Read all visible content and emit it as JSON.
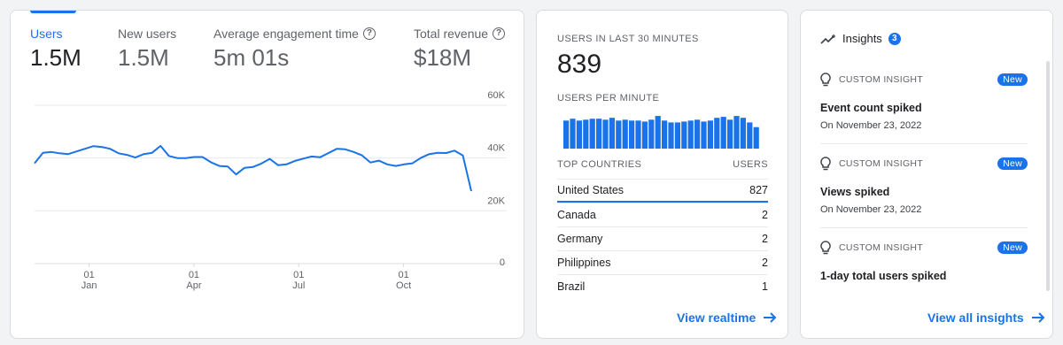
{
  "overview": {
    "metrics": [
      {
        "label": "Users",
        "value": "1.5M",
        "active": true,
        "help": false
      },
      {
        "label": "New users",
        "value": "1.5M",
        "active": false,
        "help": false
      },
      {
        "label": "Average engagement time",
        "value": "5m 01s",
        "active": false,
        "help": true
      },
      {
        "label": "Total revenue",
        "value": "$18M",
        "active": false,
        "help": true
      }
    ],
    "help_glyph": "?"
  },
  "chart_data": {
    "type": "line",
    "series": [
      {
        "values": [
          38,
          42,
          42.3,
          41.8,
          41.5,
          42.5,
          43.5,
          44.5,
          44.2,
          43.5,
          41.8,
          41.2,
          40.2,
          41.5,
          42,
          44.6,
          40.8,
          40,
          40,
          40.4,
          40.4,
          38.4,
          37,
          36.8,
          33.8,
          36.3,
          36.6,
          37.9,
          39.7,
          37.3,
          37.6,
          38.9,
          39.8,
          40.6,
          40.3,
          41.9,
          43.5,
          43.3,
          42.3,
          41,
          38.3,
          39,
          37.6,
          37,
          37.6,
          38,
          40.1,
          41.5,
          42,
          41.9,
          42.8,
          41,
          27.5
        ],
        "color": "#1a73e8"
      }
    ],
    "ylim": [
      0,
      60
    ],
    "y_ticks": [
      "0",
      "20K",
      "40K",
      "60K"
    ],
    "x_ticks": [
      {
        "day": "01",
        "month": "Jan"
      },
      {
        "day": "01",
        "month": "Apr"
      },
      {
        "day": "01",
        "month": "Jul"
      },
      {
        "day": "01",
        "month": "Oct"
      }
    ],
    "grid": true
  },
  "realtime": {
    "heading": "USERS IN LAST 30 MINUTES",
    "value": "839",
    "per_minute_heading": "USERS PER MINUTE",
    "per_minute": [
      30,
      32,
      30,
      31,
      32,
      32,
      31,
      33,
      30,
      31,
      30,
      30,
      29,
      31,
      35,
      30,
      28,
      28,
      29,
      30,
      31,
      29,
      30,
      33,
      34,
      31,
      35,
      33,
      28,
      23
    ],
    "bar_color": "#1a73e8",
    "col_country": "TOP COUNTRIES",
    "col_users": "USERS",
    "countries": [
      {
        "name": "United States",
        "users": "827"
      },
      {
        "name": "Canada",
        "users": "2"
      },
      {
        "name": "Germany",
        "users": "2"
      },
      {
        "name": "Philippines",
        "users": "2"
      },
      {
        "name": "Brazil",
        "users": "1"
      }
    ],
    "link": "View realtime"
  },
  "insights": {
    "title": "Insights",
    "count": "3",
    "items": [
      {
        "kind": "Custom insight",
        "badge": "New",
        "title": "Event count spiked",
        "date": "On November 23, 2022"
      },
      {
        "kind": "Custom insight",
        "badge": "New",
        "title": "Views spiked",
        "date": "On November 23, 2022"
      },
      {
        "kind": "Custom insight",
        "badge": "New",
        "title": "1-day total users spiked",
        "date": ""
      }
    ],
    "link": "View all insights"
  },
  "colors": {
    "accent": "#1a73e8",
    "grid": "#e8eaed",
    "text_muted": "#5f6368"
  },
  "icons": {
    "insights": "insights-sparkline-icon",
    "bulb": "lightbulb-icon",
    "arrow": "arrow-right-icon",
    "help": "help-circle-icon"
  }
}
